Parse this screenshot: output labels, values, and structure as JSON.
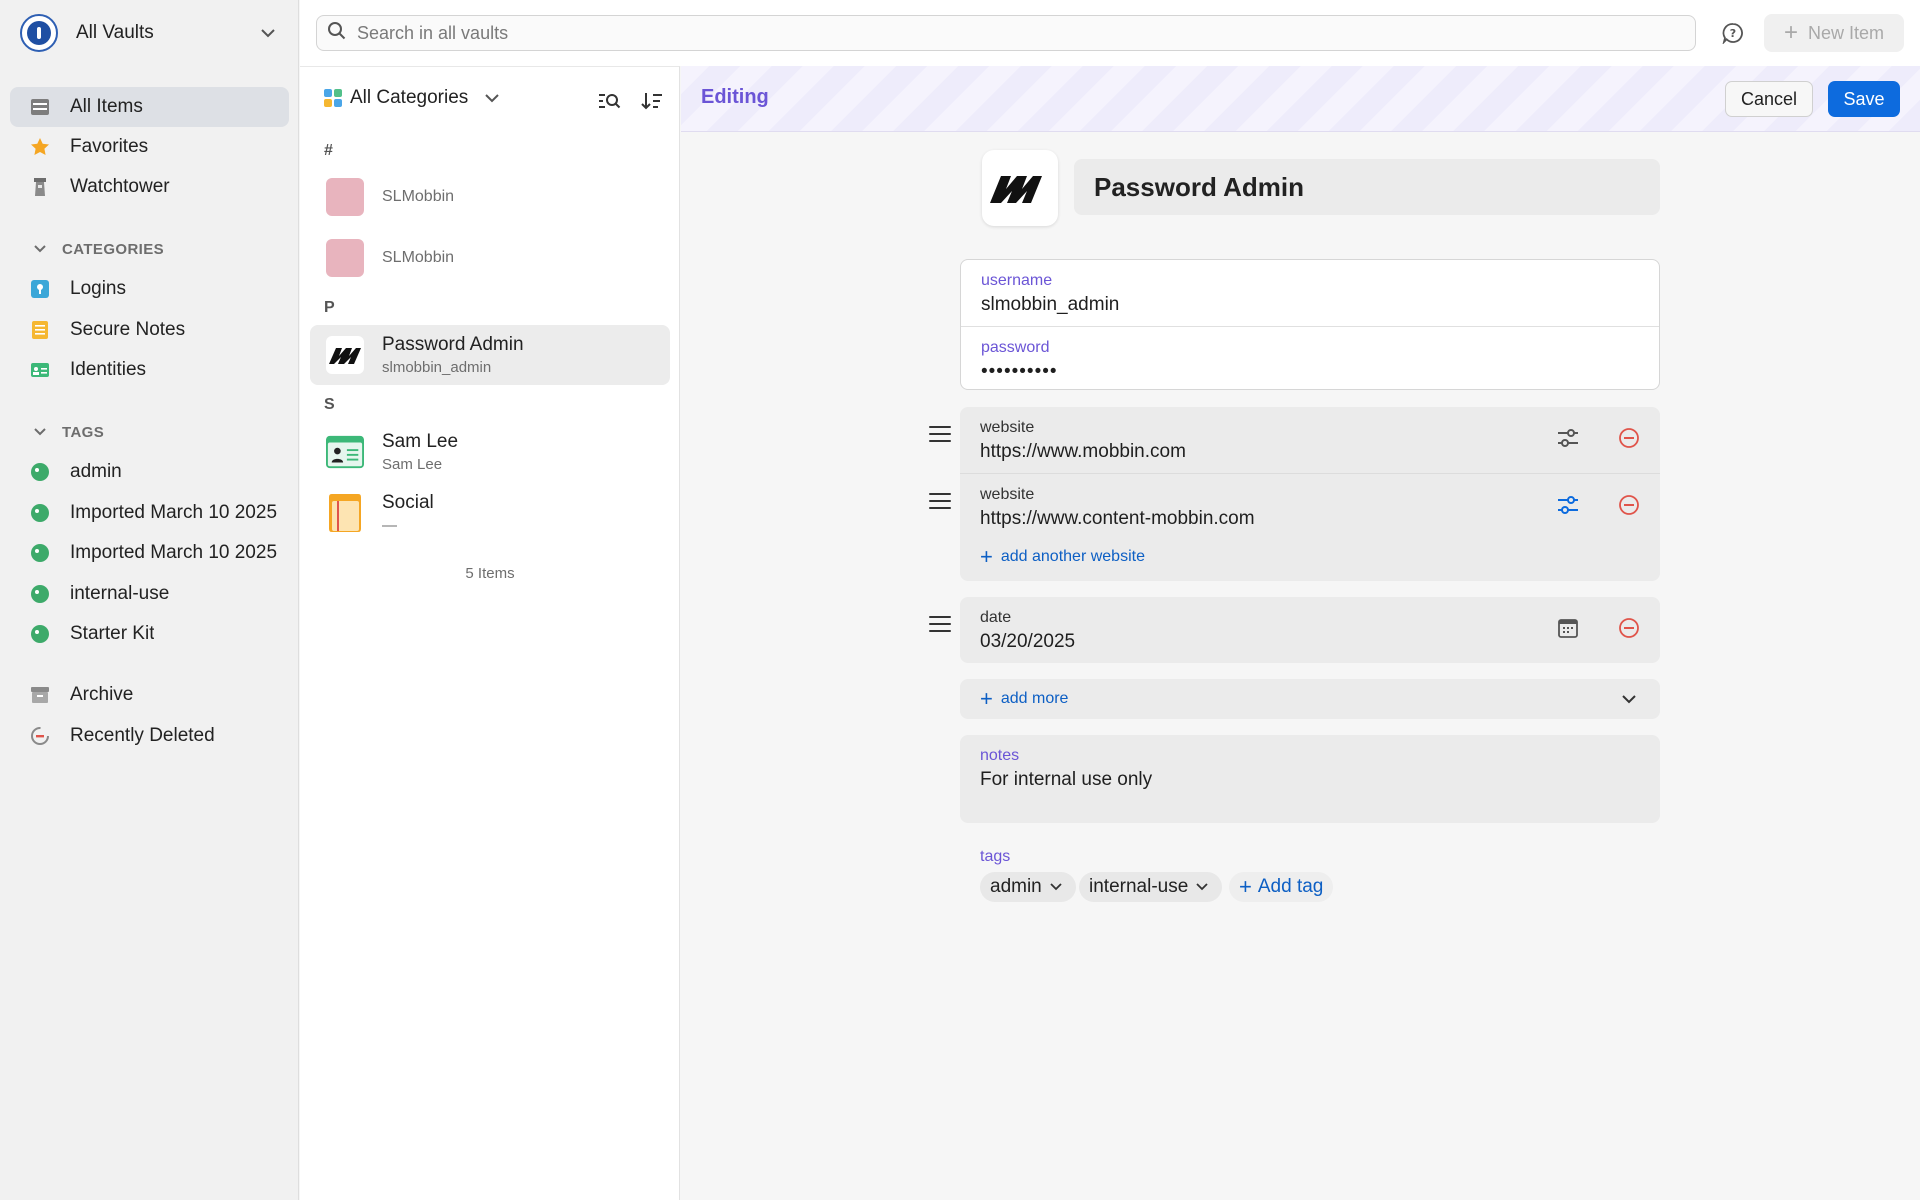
{
  "sidebar": {
    "vault_name": "All Vaults",
    "nav": [
      {
        "label": "All Items",
        "icon": "all-items-icon"
      },
      {
        "label": "Favorites",
        "icon": "star-icon"
      },
      {
        "label": "Watchtower",
        "icon": "watchtower-icon"
      }
    ],
    "categories_header": "CATEGORIES",
    "categories": [
      {
        "label": "Logins",
        "icon": "key-icon"
      },
      {
        "label": "Secure Notes",
        "icon": "note-icon"
      },
      {
        "label": "Identities",
        "icon": "id-card-icon"
      }
    ],
    "tags_header": "TAGS",
    "tags": [
      {
        "label": "admin"
      },
      {
        "label": "Imported March 10 2025"
      },
      {
        "label": "Imported March 10 2025"
      },
      {
        "label": "internal-use"
      },
      {
        "label": "Starter Kit"
      }
    ],
    "archive": "Archive",
    "recently_deleted": "Recently Deleted"
  },
  "topbar": {
    "search_placeholder": "Search in all vaults",
    "new_item_label": "New Item"
  },
  "list": {
    "category_filter": "All Categories",
    "groups": [
      "#",
      "P",
      "S"
    ],
    "items": [
      {
        "title": "SLMobbin",
        "subtitle": ""
      },
      {
        "title": "SLMobbin",
        "subtitle": ""
      },
      {
        "title": "Password Admin",
        "subtitle": "slmobbin_admin"
      },
      {
        "title": "Sam Lee",
        "subtitle": "Sam Lee"
      },
      {
        "title": "Social",
        "subtitle": "—"
      }
    ],
    "count_label": "5 Items"
  },
  "editor": {
    "status_label": "Editing",
    "cancel_label": "Cancel",
    "save_label": "Save",
    "title": "Password Admin",
    "username_label": "username",
    "username_value": "slmobbin_admin",
    "password_label": "password",
    "password_value": "••••••••••",
    "websites": [
      {
        "label": "website",
        "value": "https://www.mobbin.com"
      },
      {
        "label": "website",
        "value": "https://www.content-mobbin.com"
      }
    ],
    "add_website_label": "add another website",
    "date_label": "date",
    "date_value": "03/20/2025",
    "add_more_label": "add more",
    "notes_label": "notes",
    "notes_value": "For internal use only",
    "tags_label": "tags",
    "tags": [
      "admin",
      "internal-use"
    ],
    "add_tag_label": "Add tag"
  },
  "colors": {
    "accent_purple": "#6b55d6",
    "primary_blue": "#0d6bde",
    "tag_green": "#3daa6a",
    "danger_red": "#e0544a"
  }
}
